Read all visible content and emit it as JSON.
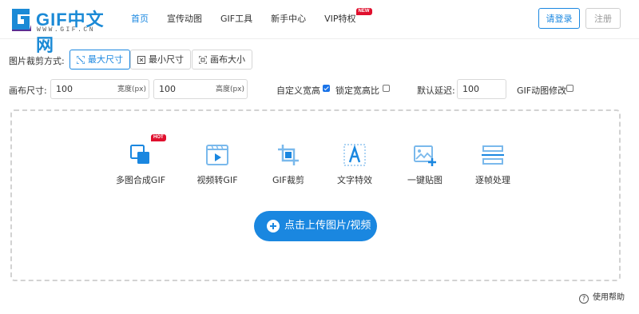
{
  "header": {
    "logo_text": "GIF中文网",
    "logo_sub": "WWW.GIF.CN",
    "nav": [
      "首页",
      "宣传动图",
      "GIF工具",
      "新手中心",
      "VIP特权"
    ],
    "vip_badge": "NEW",
    "login_label": "请登录",
    "register_label": "注册"
  },
  "crop": {
    "label": "图片裁剪方式:",
    "options": [
      "最大尺寸",
      "最小尺寸",
      "画布大小"
    ],
    "selected": "最大尺寸"
  },
  "canvas": {
    "label": "画布尺寸:",
    "width_value": "100",
    "width_unit": "宽度(px)",
    "height_value": "100",
    "height_unit": "高度(px)",
    "custom_label": "自定义宽高",
    "custom_checked": true,
    "lock_label": "锁定宽高比",
    "lock_checked": false,
    "delay_label": "默认延迟:",
    "delay_value": "100",
    "gif_edit_label": "GIF动图修改",
    "gif_edit_checked": false
  },
  "tools": {
    "hot_badge": "HOT",
    "items": [
      {
        "label": "多图合成GIF",
        "icon": "multi-image-icon"
      },
      {
        "label": "视频转GIF",
        "icon": "video-icon"
      },
      {
        "label": "GIF裁剪",
        "icon": "crop-icon"
      },
      {
        "label": "文字特效",
        "icon": "text-icon"
      },
      {
        "label": "一键贴图",
        "icon": "image-add-icon"
      },
      {
        "label": "逐帧处理",
        "icon": "frames-icon"
      }
    ]
  },
  "upload_label": "点击上传图片/视频",
  "help_label": "使用帮助",
  "colors": {
    "accent": "#1a87e0",
    "hot": "#e0102e"
  }
}
